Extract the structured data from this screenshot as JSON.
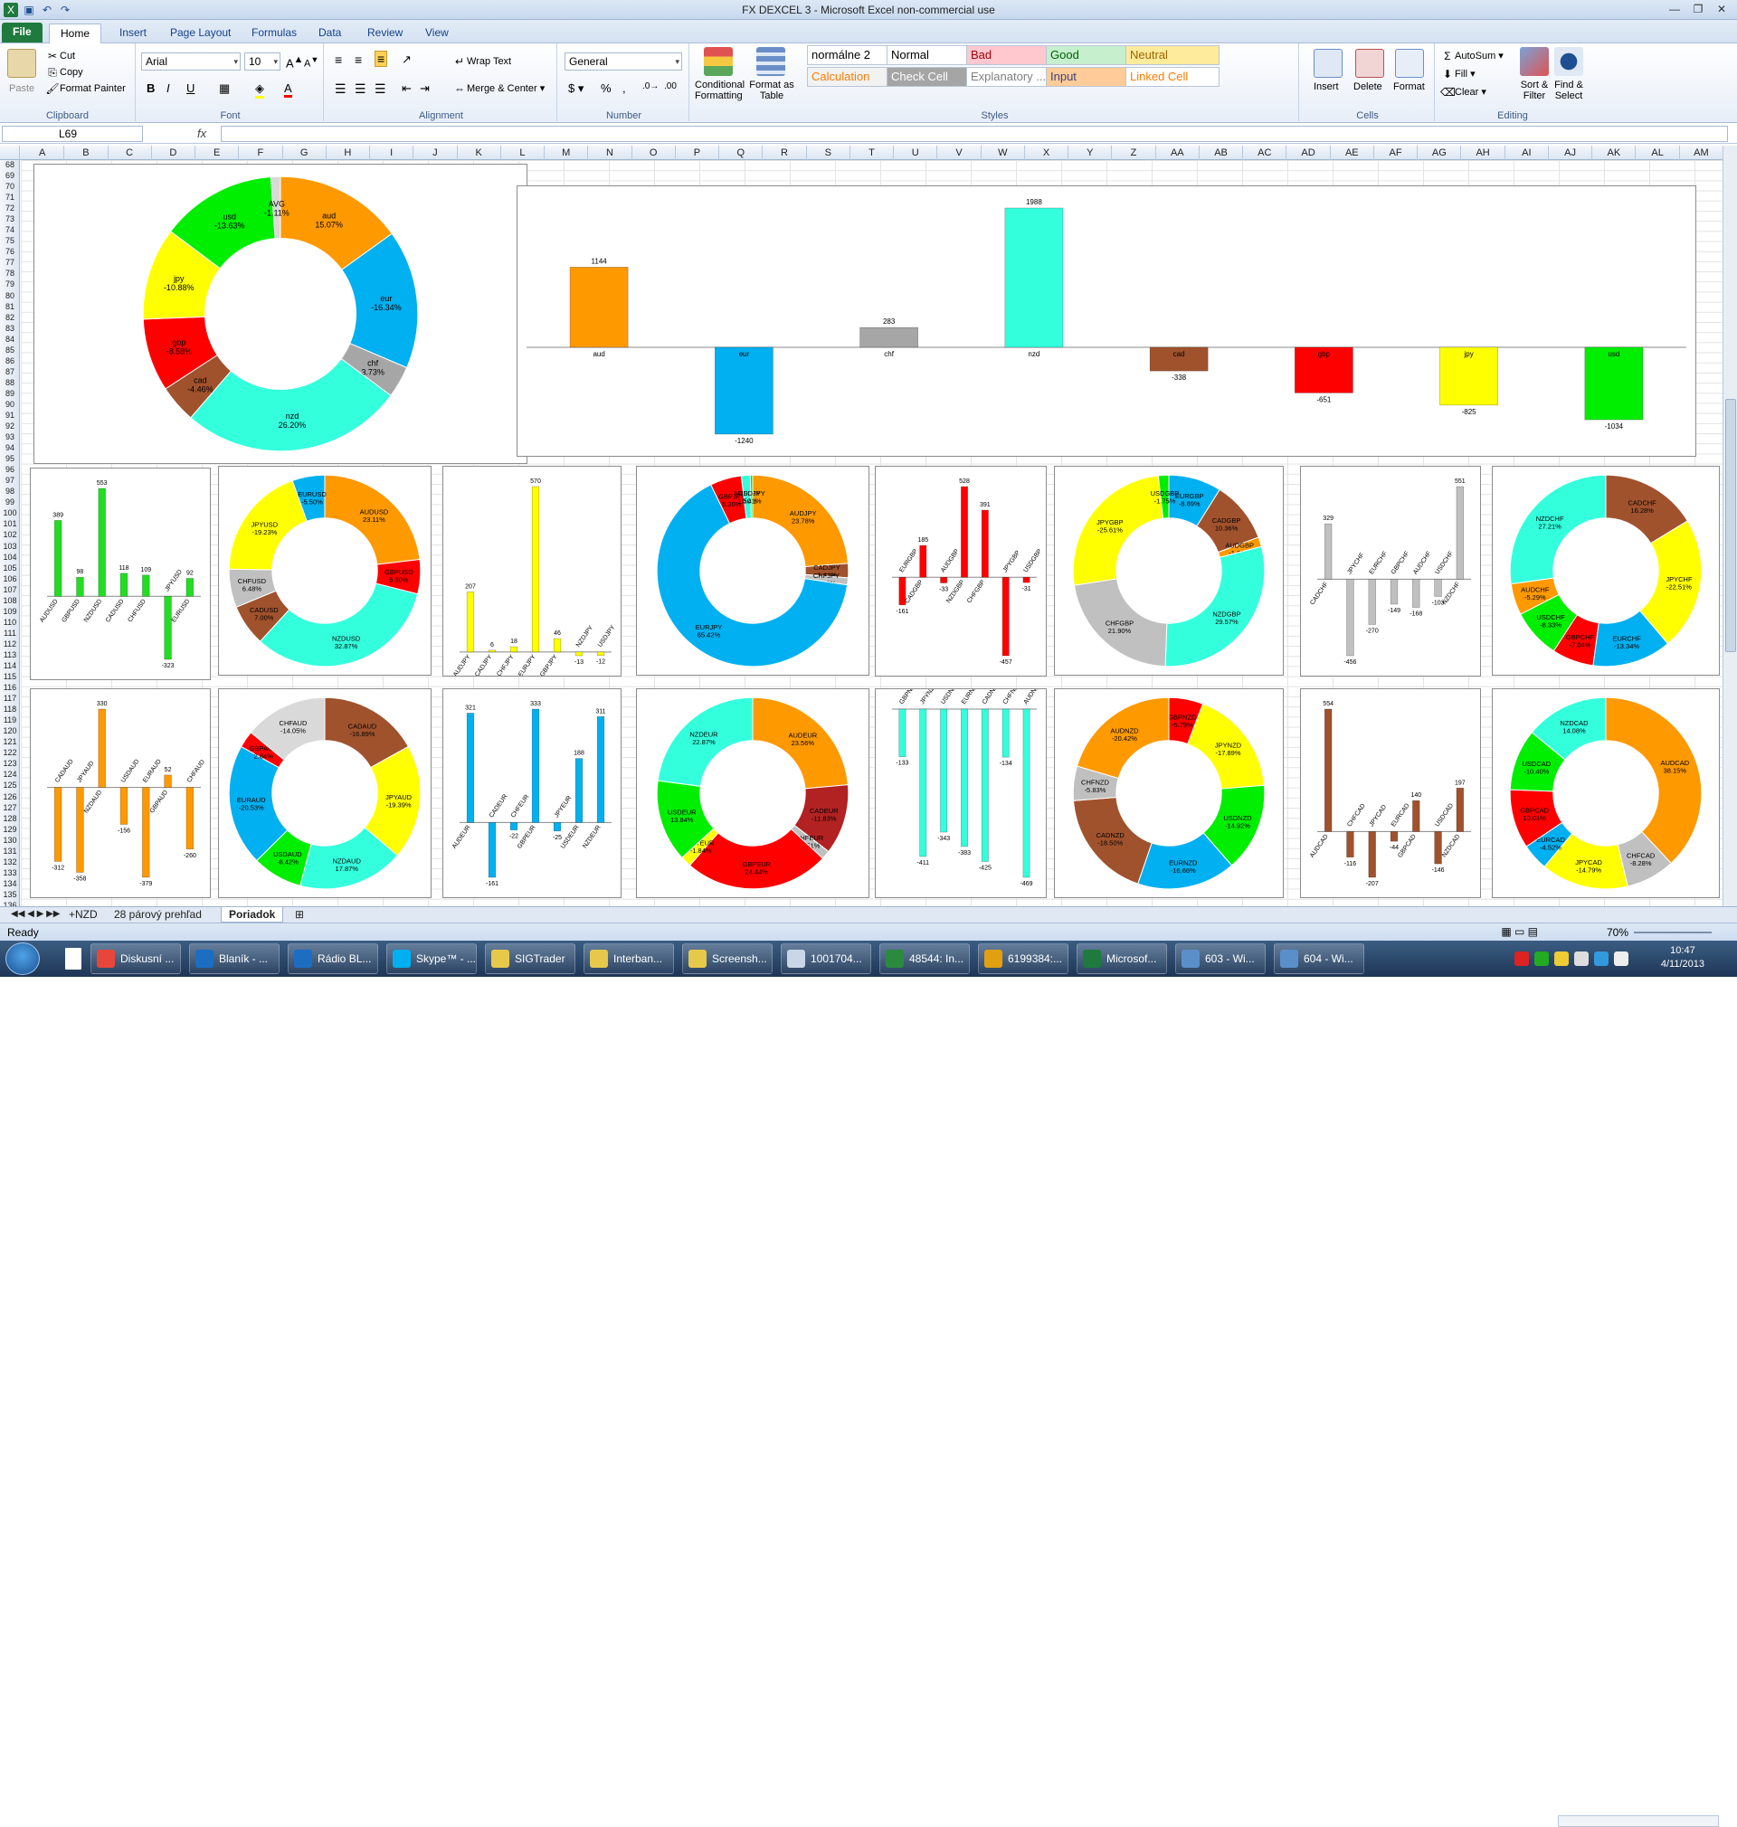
{
  "window": {
    "title": "FX DEXCEL 3 - Microsoft Excel non-commercial use"
  },
  "ribbon_tabs": [
    "File",
    "Home",
    "Insert",
    "Page Layout",
    "Formulas",
    "Data",
    "Review",
    "View"
  ],
  "clipboard": {
    "paste": "Paste",
    "cut": "Cut",
    "copy": "Copy",
    "format_painter": "Format Painter",
    "label": "Clipboard"
  },
  "font": {
    "name": "Arial",
    "size": "10",
    "label": "Font"
  },
  "alignment": {
    "wrap": "Wrap Text",
    "merge": "Merge & Center",
    "label": "Alignment"
  },
  "number": {
    "format": "General",
    "label": "Number"
  },
  "styles": {
    "conditional": "Conditional Formatting",
    "format_table": "Format as Table",
    "label": "Styles",
    "cells": [
      {
        "text": "normálne 2",
        "bg": "#ffffff",
        "fg": "#000000"
      },
      {
        "text": "Normal",
        "bg": "#ffffff",
        "fg": "#000000"
      },
      {
        "text": "Bad",
        "bg": "#ffc7ce",
        "fg": "#9c0006"
      },
      {
        "text": "Good",
        "bg": "#c6efce",
        "fg": "#006100"
      },
      {
        "text": "Neutral",
        "bg": "#ffeb9c",
        "fg": "#9c6500"
      },
      {
        "text": "Calculation",
        "bg": "#f2f2f2",
        "fg": "#fa7d00"
      },
      {
        "text": "Check Cell",
        "bg": "#a5a5a5",
        "fg": "#ffffff"
      },
      {
        "text": "Explanatory ...",
        "bg": "#ffffff",
        "fg": "#7f7f7f"
      },
      {
        "text": "Input",
        "bg": "#ffcc99",
        "fg": "#3f3f76"
      },
      {
        "text": "Linked Cell",
        "bg": "#ffffff",
        "fg": "#fa7d00"
      }
    ]
  },
  "cells_group": {
    "insert": "Insert",
    "delete": "Delete",
    "format": "Format",
    "label": "Cells"
  },
  "editing": {
    "autosum": "AutoSum",
    "fill": "Fill",
    "clear": "Clear",
    "sort": "Sort & Filter",
    "find": "Find & Select",
    "label": "Editing"
  },
  "formula_bar": {
    "namebox": "L69",
    "fx": "fx",
    "value": ""
  },
  "columns": [
    "A",
    "B",
    "C",
    "D",
    "E",
    "F",
    "G",
    "H",
    "I",
    "J",
    "K",
    "L",
    "M",
    "N",
    "O",
    "P",
    "Q",
    "R",
    "S",
    "T",
    "U",
    "V",
    "W",
    "X",
    "Y",
    "Z",
    "AA",
    "AB",
    "AC",
    "AD",
    "AE",
    "AF",
    "AG",
    "AH",
    "AI",
    "AJ",
    "AK",
    "AL",
    "AM"
  ],
  "row_start": 68,
  "row_end": 136,
  "sheets": [
    "+NZD",
    "28 párový prehľad",
    "Poriadok"
  ],
  "active_sheet": "Poriadok",
  "status": {
    "ready": "Ready",
    "zoom": "70%"
  },
  "taskbar": {
    "items": [
      {
        "label": "Diskusní ...",
        "color": "#e8463a"
      },
      {
        "label": "Blaník - ...",
        "color": "#1b6ec2"
      },
      {
        "label": "Rádio BL...",
        "color": "#1b6ec2"
      },
      {
        "label": "Skype™ - ...",
        "color": "#00aff0"
      },
      {
        "label": "SIGTrader",
        "color": "#e6c84a"
      },
      {
        "label": "Interban...",
        "color": "#e6c84a"
      },
      {
        "label": "Screensh...",
        "color": "#e6c84a"
      },
      {
        "label": "1001704...",
        "color": "#c9d6e8"
      },
      {
        "label": "48544: In...",
        "color": "#2b8a3e"
      },
      {
        "label": "6199384:...",
        "color": "#e0a010"
      },
      {
        "label": "Microsof...",
        "color": "#1f7a3d"
      },
      {
        "label": "603 - Wi...",
        "color": "#5b8fc9"
      },
      {
        "label": "604 - Wi...",
        "color": "#5b8fc9"
      }
    ],
    "time": "10:47",
    "date": "4/11/2013"
  },
  "chart_data": [
    {
      "type": "pie",
      "name": "main-donut",
      "labels": [
        "aud",
        "eur",
        "chf",
        "nzd",
        "cad",
        "gbp",
        "jpy",
        "usd",
        "AVG"
      ],
      "values": [
        15.07,
        -16.34,
        3.73,
        26.2,
        -4.46,
        -8.58,
        -10.88,
        -13.63,
        -1.11
      ],
      "pct_labels": [
        "15.07%",
        "-16.34%",
        "3.73%",
        "26.20%",
        "-4.46%",
        "-8.58%",
        "-10.88%",
        "-13.63%",
        "-1.11%"
      ],
      "colors": [
        "#ff9900",
        "#00b0f0",
        "#a6a6a6",
        "#33ffdd",
        "#a0522d",
        "#ff0000",
        "#ffff00",
        "#00ee00",
        "#d9d9d9"
      ]
    },
    {
      "type": "bar",
      "name": "main-bar",
      "categories": [
        "aud",
        "eur",
        "chf",
        "nzd",
        "cad",
        "gbp",
        "jpy",
        "usd"
      ],
      "values": [
        1144,
        -1240,
        283,
        1988,
        -338,
        -651,
        -825,
        -1034
      ],
      "colors": [
        "#ff9900",
        "#00b0f0",
        "#a6a6a6",
        "#33ffdd",
        "#a0522d",
        "#ff0000",
        "#ffff00",
        "#00ee00"
      ]
    },
    {
      "type": "bar",
      "name": "usd-bar",
      "categories": [
        "AUDUSD",
        "GBPUSD",
        "NZDUSD",
        "CADUSD",
        "CHFUSD",
        "JPYUSD",
        "EURUSD"
      ],
      "values": [
        389,
        98,
        553,
        118,
        109,
        -323,
        92
      ],
      "color": "#22dd22"
    },
    {
      "type": "pie",
      "name": "usd-donut",
      "labels": [
        "AUDUSD",
        "GBPUSD",
        "NZDUSD",
        "CADUSD",
        "CHFUSD",
        "JPYUSD",
        "EURUSD"
      ],
      "values": [
        23.11,
        5.8,
        32.87,
        7.0,
        6.48,
        19.23,
        5.5
      ],
      "pct_labels": [
        "23.11%",
        "5.80%",
        "32.87%",
        "7.00%",
        "6.48%",
        "-19.23%",
        "-5.50%"
      ],
      "colors": [
        "#ff9900",
        "#ff0000",
        "#33ffdd",
        "#a0522d",
        "#c0c0c0",
        "#ffff00",
        "#00b0f0"
      ]
    },
    {
      "type": "bar",
      "name": "jpy-bar",
      "categories": [
        "AUDJPY",
        "CADJPY",
        "CHFJPY",
        "EURJPY",
        "GBPJPY",
        "NZDJPY",
        "USDJPY"
      ],
      "values": [
        207,
        6,
        18,
        570,
        46,
        -13,
        -12
      ],
      "color": "#ffff00"
    },
    {
      "type": "pie",
      "name": "jpy-donut",
      "labels": [
        "AUDJPY",
        "CADJPY",
        "CHFJPY",
        "EURJPY",
        "GBPJPY",
        "NZDJPY",
        "USDJPY"
      ],
      "values": [
        23.78,
        2.41,
        1.18,
        65.42,
        5.3,
        1.5,
        0.41
      ],
      "pct_labels": [
        "23.78%",
        "2.41%",
        "1.18%",
        "65.42%",
        "5.30%",
        "1.50%",
        "0.41%"
      ],
      "colors": [
        "#ff9900",
        "#a0522d",
        "#c0c0c0",
        "#00b0f0",
        "#ff0000",
        "#33ffdd",
        "#00ee00"
      ]
    },
    {
      "type": "bar",
      "name": "gbp-bar",
      "categories": [
        "EURGBP",
        "CADGBP",
        "AUDGBP",
        "NZDGBP",
        "CHFGBP",
        "JPYGBP",
        "USDGBP"
      ],
      "values": [
        -161,
        185,
        -33,
        528,
        391,
        -457,
        -31
      ],
      "color": "#ff0000"
    },
    {
      "type": "pie",
      "name": "gbp-donut",
      "labels": [
        "EURGBP",
        "CADGBP",
        "AUDGBP",
        "NZDGBP",
        "CHFGBP",
        "JPYGBP",
        "USDGBP"
      ],
      "values": [
        8.89,
        10.36,
        1.62,
        29.57,
        21.9,
        25.61,
        1.75
      ],
      "pct_labels": [
        "-8.89%",
        "10.36%",
        "-1.62%",
        "29.57%",
        "21.90%",
        "-25.61%",
        "-1.75%"
      ],
      "colors": [
        "#00b0f0",
        "#a0522d",
        "#ff9900",
        "#33ffdd",
        "#c0c0c0",
        "#ffff00",
        "#00ee00"
      ]
    },
    {
      "type": "bar",
      "name": "chf-bar",
      "categories": [
        "CADCHF",
        "JPYCHF",
        "EURCHF",
        "GBPCHF",
        "AUDCHF",
        "USDCHF",
        "NZDCHF"
      ],
      "values": [
        329,
        -456,
        -270,
        -149,
        -168,
        -103,
        551
      ],
      "color": "#c0c0c0"
    },
    {
      "type": "pie",
      "name": "chf-donut",
      "labels": [
        "CADCHF",
        "JPYCHF",
        "EURCHF",
        "GBPCHF",
        "USDCHF",
        "AUDCHF",
        "NZDCHF"
      ],
      "values": [
        16.28,
        22.51,
        13.34,
        7.04,
        8.33,
        5.29,
        27.21
      ],
      "pct_labels": [
        "16.28%",
        "-22.51%",
        "-13.34%",
        "-7.04%",
        "-8.33%",
        "-5.29%",
        "27.21%"
      ],
      "colors": [
        "#a0522d",
        "#ffff00",
        "#00b0f0",
        "#ff0000",
        "#00ee00",
        "#ff9900",
        "#33ffdd"
      ]
    },
    {
      "type": "bar",
      "name": "aud-bar",
      "categories": [
        "CADAUD",
        "JPYAUD",
        "NZDAUD",
        "USDAUD",
        "EURAUD",
        "GBPAUD",
        "CHFAUD"
      ],
      "values": [
        -312,
        -358,
        330,
        -156,
        -379,
        52,
        -260
      ],
      "color": "#ff9900"
    },
    {
      "type": "pie",
      "name": "aud-donut",
      "labels": [
        "CADAUD",
        "JPYAUD",
        "NZDAUD",
        "USDAUD",
        "EURAUD",
        "GBPAUD",
        "CHFAUD"
      ],
      "values": [
        16.89,
        19.39,
        17.87,
        8.42,
        20.53,
        2.84,
        14.05
      ],
      "pct_labels": [
        "-16.89%",
        "-19.39%",
        "17.87%",
        "-8.42%",
        "-20.53%",
        "2.84%",
        "-14.05%"
      ],
      "colors": [
        "#a0522d",
        "#ffff00",
        "#33ffdd",
        "#00ee00",
        "#00b0f0",
        "#ff0000",
        "#d9d9d9"
      ]
    },
    {
      "type": "bar",
      "name": "eur-bar",
      "categories": [
        "AUDEUR",
        "CADEUR",
        "CHFEUR",
        "GBPEUR",
        "JPYEUR",
        "USDEUR",
        "NZDEUR"
      ],
      "values": [
        321,
        -161,
        -22,
        333,
        -25,
        188,
        311
      ],
      "color": "#00b0f0"
    },
    {
      "type": "pie",
      "name": "eur-donut",
      "labels": [
        "AUDEUR",
        "CADEUR",
        "CHFEUR",
        "GBPEUR",
        "JPYEUR",
        "USDEUR",
        "NZDEUR"
      ],
      "values": [
        23.56,
        11.83,
        1.51,
        24.44,
        1.84,
        13.84,
        22.87
      ],
      "pct_labels": [
        "23.56%",
        "-11.83%",
        "-1.51%",
        "24.44%",
        "-1.84%",
        "13.84%",
        "22.87%"
      ],
      "colors": [
        "#ff9900",
        "#b22222",
        "#c0c0c0",
        "#ff0000",
        "#ffff00",
        "#00ee00",
        "#33ffdd"
      ]
    },
    {
      "type": "bar",
      "name": "nzd-bar",
      "categories": [
        "GBPNZD",
        "JPYNZD",
        "USDNZD",
        "EURNZD",
        "CADNZD",
        "CHFNZD",
        "AUDNZD"
      ],
      "values": [
        -133,
        -411,
        -343,
        -383,
        -425,
        -134,
        -469
      ],
      "color": "#33ffdd"
    },
    {
      "type": "pie",
      "name": "nzd-donut",
      "labels": [
        "GBPNZD",
        "JPYNZD",
        "USDNZD",
        "EURNZD",
        "CADNZD",
        "CHFNZD",
        "AUDNZD"
      ],
      "values": [
        5.79,
        17.89,
        14.92,
        16.66,
        18.5,
        5.83,
        20.42
      ],
      "pct_labels": [
        "-5.79%",
        "-17.89%",
        "-14.92%",
        "-16.66%",
        "-18.50%",
        "-5.83%",
        "-20.42%"
      ],
      "colors": [
        "#ff0000",
        "#ffff00",
        "#00ee00",
        "#00b0f0",
        "#a0522d",
        "#c0c0c0",
        "#ff9900"
      ]
    },
    {
      "type": "bar",
      "name": "cad-bar",
      "categories": [
        "AUDCAD",
        "CHFCAD",
        "JPYCAD",
        "EURCAD",
        "GBPCAD",
        "USDCAD",
        "NZDCAD"
      ],
      "values": [
        554,
        -116,
        -207,
        -44,
        140,
        -146,
        197
      ],
      "color": "#a0522d"
    },
    {
      "type": "pie",
      "name": "cad-donut",
      "labels": [
        "AUDCAD",
        "CHFCAD",
        "JPYCAD",
        "EURCAD",
        "GBPCAD",
        "USDCAD",
        "NZDCAD"
      ],
      "values": [
        38.15,
        8.28,
        14.79,
        4.52,
        10.01,
        10.4,
        14.08
      ],
      "pct_labels": [
        "38.15%",
        "-8.28%",
        "-14.79%",
        "-4.52%",
        "10.01%",
        "-10.40%",
        "14.08%"
      ],
      "colors": [
        "#ff9900",
        "#c0c0c0",
        "#ffff00",
        "#00b0f0",
        "#ff0000",
        "#00ee00",
        "#33ffdd"
      ]
    }
  ]
}
